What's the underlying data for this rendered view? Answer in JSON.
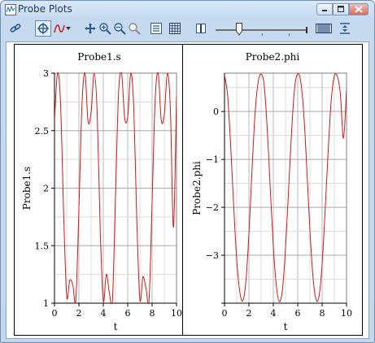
{
  "window": {
    "title": "Probe Plots"
  },
  "toolbar": {
    "icons": [
      "link-icon",
      "crosshair-select-icon",
      "curve-style-icon",
      "dropdown-arrow-icon",
      "pan-icon",
      "zoom-in-icon",
      "zoom-out-icon",
      "zoom-fit-icon",
      "data-list-icon",
      "grid-icon",
      "cursor-line-icon",
      "timeline-slider",
      "resolution-icon",
      "fit-vertical-icon"
    ],
    "slider_position": 0.25
  },
  "colors": {
    "curve": "#d31717",
    "grid": "#dcdcdc",
    "window_frame": "#c3d8ee",
    "title_text": "#1e395b"
  },
  "plots": [
    {
      "title": "Probe1.s",
      "xlabel": "t",
      "ylabel": "Probe1.s"
    },
    {
      "title": "Probe2.phi",
      "xlabel": "t",
      "ylabel": "Probe2.phi"
    }
  ],
  "chart_data": [
    {
      "type": "line",
      "title": "Probe1.s",
      "xlabel": "t",
      "ylabel": "Probe1.s",
      "xlim": [
        0,
        10
      ],
      "ylim": [
        1,
        3
      ],
      "xticks": [
        0,
        2,
        4,
        6,
        8,
        10
      ],
      "yticks": [
        1,
        1.5,
        2,
        2.5,
        3
      ],
      "ytick_labels": [
        "1",
        "1.5",
        "2",
        "2.5",
        "3"
      ],
      "grid": true,
      "series": [
        {
          "color": "#d31717",
          "x": [
            0,
            0.25,
            0.5,
            0.75,
            1.0,
            1.25,
            1.5,
            1.75,
            2.0,
            2.25,
            2.5,
            2.75,
            3.0,
            3.25,
            3.5,
            3.75,
            4.0,
            4.25,
            4.5,
            4.75,
            5.0,
            5.25,
            5.5,
            5.75,
            6.0,
            6.25,
            6.5,
            6.75,
            7.0,
            7.25,
            7.5,
            7.75,
            8.0,
            8.25,
            8.5,
            8.75,
            9.0,
            9.25,
            9.5,
            9.75,
            10.0
          ],
          "y": [
            2.59,
            3.0,
            2.73,
            1.78,
            1.06,
            1.2,
            1.16,
            1.03,
            1.82,
            2.72,
            3.0,
            2.58,
            2.66,
            3.0,
            2.65,
            1.63,
            1.02,
            1.25,
            1.09,
            1.02,
            1.94,
            2.83,
            3.0,
            2.61,
            2.62,
            3.0,
            2.69,
            1.7,
            1.03,
            1.23,
            1.13,
            1.03,
            1.88,
            2.77,
            3.0,
            2.59,
            2.64,
            3.0,
            2.68,
            1.66,
            2.8
          ]
        }
      ]
    },
    {
      "type": "line",
      "title": "Probe2.phi",
      "xlabel": "t",
      "ylabel": "Probe2.phi",
      "xlim": [
        0,
        10
      ],
      "ylim": [
        -4,
        0.8
      ],
      "xticks": [
        0,
        2,
        4,
        6,
        8,
        10
      ],
      "yticks": [
        0,
        -1,
        -2,
        -3
      ],
      "ytick_labels": [
        "0",
        "−1",
        "−2",
        "−3"
      ],
      "grid": true,
      "series": [
        {
          "color": "#d31717",
          "x": [
            0,
            0.25,
            0.5,
            0.75,
            1.0,
            1.25,
            1.5,
            1.75,
            2.0,
            2.25,
            2.5,
            2.75,
            3.0,
            3.25,
            3.5,
            3.75,
            4.0,
            4.25,
            4.5,
            4.75,
            5.0,
            5.25,
            5.5,
            5.75,
            6.0,
            6.25,
            6.5,
            6.75,
            7.0,
            7.25,
            7.5,
            7.75,
            8.0,
            8.25,
            8.5,
            8.75,
            9.0,
            9.25,
            9.5,
            9.75,
            10.0
          ],
          "y": [
            0.76,
            0.35,
            -0.69,
            -1.96,
            -3.09,
            -3.76,
            -3.95,
            -3.55,
            -2.56,
            -1.24,
            -0.05,
            0.6,
            0.78,
            0.55,
            -0.36,
            -1.6,
            -2.81,
            -3.64,
            -3.97,
            -3.71,
            -2.86,
            -1.64,
            -0.41,
            0.5,
            0.79,
            0.62,
            -0.06,
            -1.22,
            -2.48,
            -3.45,
            -3.92,
            -3.85,
            -3.19,
            -2.05,
            -0.8,
            0.24,
            0.74,
            0.73,
            0.35,
            -0.56,
            0.45
          ]
        }
      ]
    }
  ]
}
